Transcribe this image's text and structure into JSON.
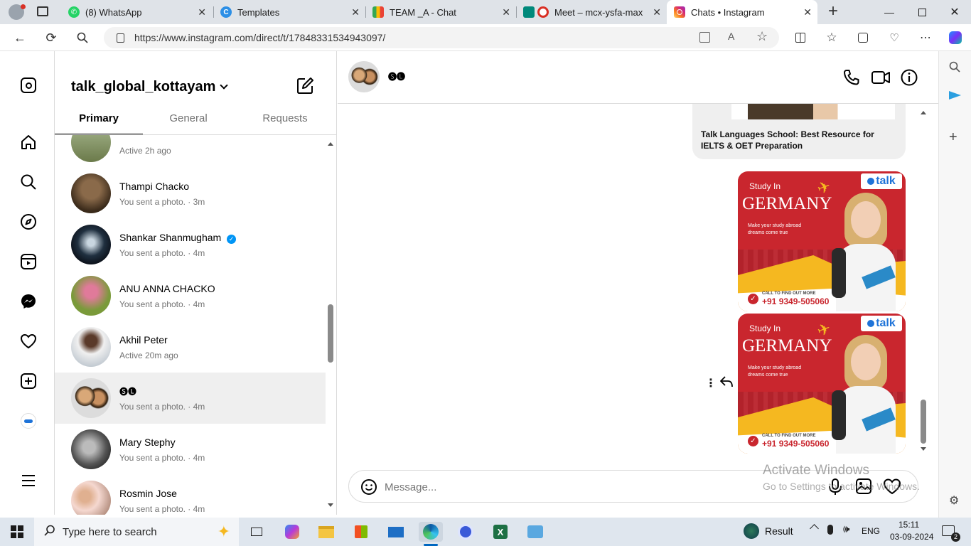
{
  "browser": {
    "tabs": [
      {
        "title": "(8) WhatsApp",
        "icon": "whatsapp-icon",
        "color": "#25d366"
      },
      {
        "title": "Templates",
        "icon": "canva-icon",
        "color": "#2c8fe6"
      },
      {
        "title": "TEAM _A - Chat",
        "icon": "google-chat-icon",
        "color": "#e94235"
      },
      {
        "title": "Meet – mcx-ysfa-max",
        "icon": "google-meet-icon",
        "color": "#e8423b"
      },
      {
        "title": "Chats • Instagram",
        "icon": "instagram-icon",
        "color": "#d6249f"
      }
    ],
    "url": "https://www.instagram.com/direct/t/17848331534943097/"
  },
  "inbox": {
    "username": "talk_global_kottayam",
    "tabs": [
      "Primary",
      "General",
      "Requests"
    ],
    "active_tab": "Primary",
    "conversations": [
      {
        "name": "",
        "sub": "Active 2h ago",
        "avatar_color": "#6b7a4a"
      },
      {
        "name": "Thampi Chacko",
        "sub": "You sent a photo. · 3m",
        "avatar_color": "#4a3a2a"
      },
      {
        "name": "Shankar Shanmugham",
        "sub": "You sent a photo. · 4m",
        "verified": true,
        "avatar_color": "#1a2a3a"
      },
      {
        "name": "ANU ANNA CHACKO",
        "sub": "You sent a photo. · 4m",
        "avatar_color": "#7a9a3a"
      },
      {
        "name": "Akhil Peter",
        "sub": "Active 20m ago",
        "avatar_color": "#d8d8d8"
      },
      {
        "name": "🅢🅛",
        "sub": "You sent a photo. · 4m",
        "selected": true,
        "avatar_color": "#c89a6a"
      },
      {
        "name": "Mary Stephy",
        "sub": "You sent a photo. · 4m",
        "avatar_color": "#777777"
      },
      {
        "name": "Rosmin Jose",
        "sub": "You sent a photo. · 4m",
        "avatar_color": "#b08a7a"
      }
    ]
  },
  "chat": {
    "contact_name": "🅢🅛",
    "link_preview_title": "Talk Languages School: Best Resource for IELTS & OET Preparation",
    "ad": {
      "line1": "Study In",
      "line2": "GERMANY",
      "tagline": "Make your study abroad dreams come true",
      "call_label": "CALL TO FIND OUT MORE",
      "phone": "+91 9349-505060",
      "brand": "talk"
    },
    "composer_placeholder": "Message..."
  },
  "watermark": {
    "line1": "Activate Windows",
    "line2": "Go to Settings to activate Windows."
  },
  "taskbar": {
    "search_placeholder": "Type here to search",
    "weather_label": "Result",
    "language": "ENG",
    "time": "15:11",
    "date": "03-09-2024",
    "notification_count": "2"
  }
}
